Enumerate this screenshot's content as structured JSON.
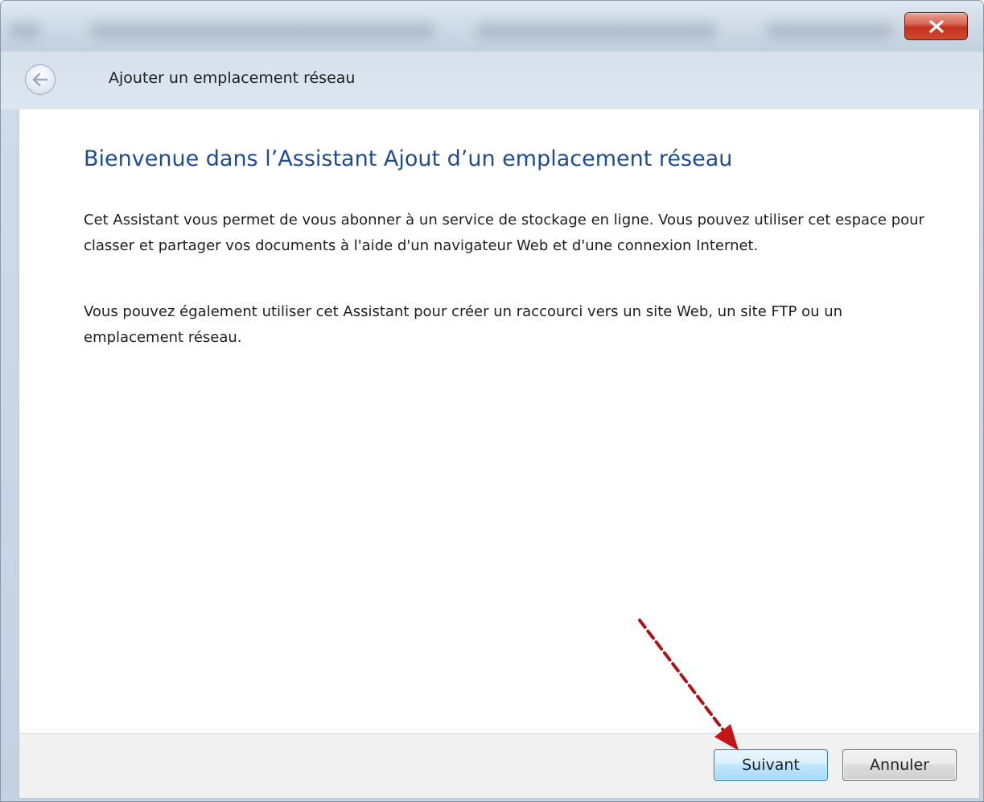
{
  "window": {
    "nav_title": "Ajouter un emplacement réseau"
  },
  "wizard": {
    "heading": "Bienvenue dans l’Assistant Ajout d’un emplacement réseau",
    "paragraph1": "Cet Assistant vous permet de vous abonner à un service de stockage en ligne. Vous pouvez utiliser cet espace pour classer et partager vos documents à l'aide d'un navigateur Web et d'une connexion Internet.",
    "paragraph2": "Vous pouvez également utiliser cet Assistant pour créer un raccourci vers un site Web, un site FTP ou un emplacement réseau."
  },
  "buttons": {
    "next": "Suivant",
    "cancel": "Annuler"
  },
  "icons": {
    "close": "close-icon",
    "back": "back-arrow-icon"
  },
  "colors": {
    "heading": "#1f4d8c",
    "close_button": "#c3321c",
    "annotation_arrow": "#a8161a"
  }
}
